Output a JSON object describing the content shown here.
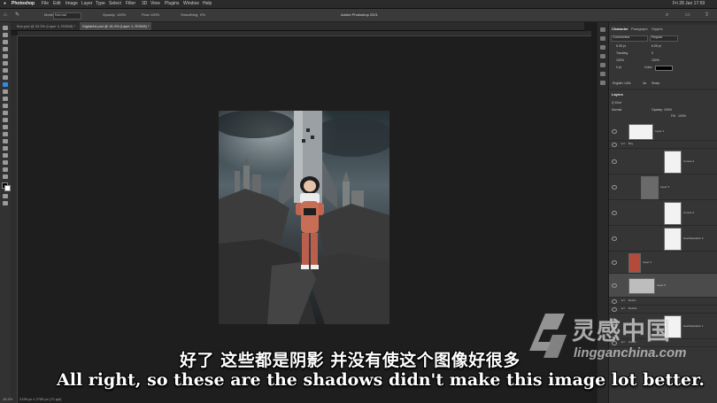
{
  "menubar": {
    "app": "Photoshop",
    "items": [
      "File",
      "Edit",
      "Image",
      "Layer",
      "Type",
      "Select",
      "Filter",
      "3D",
      "View",
      "Plugins",
      "Window",
      "Help"
    ],
    "clock": "Fri 28 Jan  17:59"
  },
  "window": {
    "title": "Adobe Photoshop 2021"
  },
  "options": {
    "mode_label": "Mode:",
    "mode_value": "Normal",
    "opacity_label": "Opacity:",
    "opacity_value": "100%",
    "flow_label": "Flow:",
    "flow_value": "100%",
    "smoothing_label": "Smoothing:",
    "smoothing_value": "0%"
  },
  "tabs": [
    {
      "label": "Bos.psd @ 33.3% (Layer 4, RGB/8) *"
    },
    {
      "label": "DigitalArt.psd @ 16.4% (Layer 1, RGB/8) *"
    }
  ],
  "character_panel": {
    "tabs": [
      "Character",
      "Paragraph",
      "Glyphs"
    ],
    "font": "Cochinchina",
    "style": "Regular",
    "size": "6.05 pt",
    "leading": "6.05 pt",
    "tracking": "Tracking",
    "kerning": "0",
    "scale_v": "100%",
    "scale_h": "100%",
    "baseline": "0 pt",
    "color_label": "Color:",
    "language": "English: USA",
    "aa": "3a",
    "aa_mode": "Sharp"
  },
  "layers_panel": {
    "title": "Layers",
    "kind_label": "Q Kind",
    "blend_mode": "Normal",
    "opacity_label": "Opacity:",
    "opacity_value": "100%",
    "fill_label": "Fill:",
    "fill_value": "100%",
    "layers": [
      {
        "name": "Layer 1"
      },
      {
        "name": "Boy"
      },
      {
        "name": "Curves 4"
      },
      {
        "name": "Layer 3"
      },
      {
        "name": "Curves 3"
      },
      {
        "name": "Hue/Saturation 2"
      },
      {
        "name": "Layer 2"
      },
      {
        "name": "Layer 5"
      },
      {
        "name": "Rocks"
      },
      {
        "name": "Rocket"
      },
      {
        "name": "Hue/Saturation 1"
      },
      {
        "name": "Castle"
      }
    ]
  },
  "status": {
    "zoom": "16.4%",
    "doc": "2199 px x 2759 px (72 ppi)"
  },
  "subtitles": {
    "chinese": "好了 这些都是阴影 并没有使这个图像好很多",
    "english": "All right, so these are the shadows didn't make this image lot better."
  },
  "watermark": {
    "name": "灵感中国",
    "url": "lingganchina.com"
  },
  "colors": {
    "accent": "#2d8ceb",
    "panel": "#353535",
    "canvas": "#1e1e1e"
  }
}
